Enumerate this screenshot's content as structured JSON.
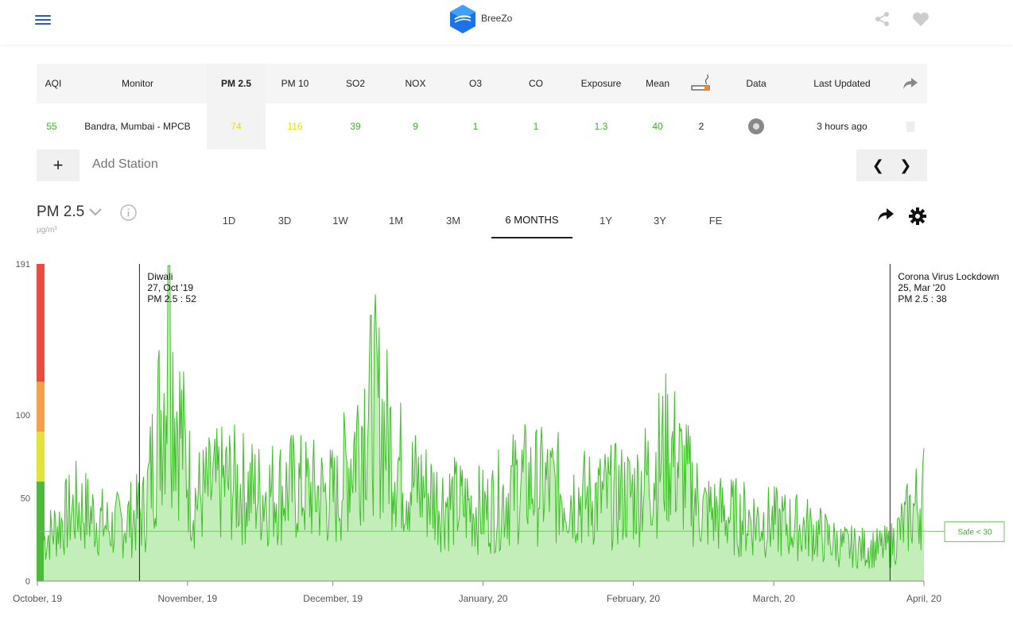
{
  "header": {
    "brand": "BreeZo"
  },
  "table": {
    "columns": [
      "AQI",
      "Monitor",
      "PM 2.5",
      "PM 10",
      "SO2",
      "NOX",
      "O3",
      "CO",
      "Exposure",
      "Mean",
      "Data",
      "Last Updated"
    ],
    "row": {
      "aqi": "55",
      "monitor": "Bandra, Mumbai - MPCB",
      "pm25": "74",
      "pm10": "116",
      "so2": "39",
      "nox": "9",
      "o3": "1",
      "co": "1",
      "exposure": "1.3",
      "mean": "40",
      "cigarettes": "2",
      "last_updated": "3 hours ago"
    }
  },
  "add_station": {
    "placeholder": "Add Station",
    "plus": "+"
  },
  "metric": {
    "name": "PM 2.5",
    "unit": "µg/m³"
  },
  "tabs": [
    "1D",
    "3D",
    "1W",
    "1M",
    "3M",
    "6 MONTHS",
    "1Y",
    "3Y",
    "FE"
  ],
  "active_tab": "6 MONTHS",
  "colors": {
    "accent": "#2f56c9",
    "series": "#3fbf2a",
    "fill": "#c4eeb9",
    "good": "#4cba3a",
    "moderate": "#e3e43a",
    "poor": "#f5a04a",
    "severe": "#ee4b40"
  },
  "chart_data": {
    "type": "area",
    "x": [
      "2019-10-01",
      "2019-10-08",
      "2019-10-15",
      "2019-10-22",
      "2019-10-27",
      "2019-11-01",
      "2019-11-08",
      "2019-11-15",
      "2019-11-22",
      "2019-12-01",
      "2019-12-08",
      "2019-12-15",
      "2019-12-22",
      "2020-01-01",
      "2020-01-08",
      "2020-01-15",
      "2020-01-22",
      "2020-02-01",
      "2020-02-08",
      "2020-02-15",
      "2020-02-22",
      "2020-03-01",
      "2020-03-08",
      "2020-03-15",
      "2020-03-22",
      "2020-03-25",
      "2020-04-01"
    ],
    "series": [
      {
        "values": [
          35,
          65,
          45,
          60,
          190,
          70,
          85,
          75,
          80,
          72,
          160,
          90,
          70,
          60,
          85,
          80,
          70,
          75,
          115,
          60,
          55,
          50,
          45,
          30,
          28,
          30,
          75
        ]
      }
    ],
    "tick_labels": [
      "October, 19",
      "November, 19",
      "December, 19",
      "January, 20",
      "February, 20",
      "March, 20",
      "April, 20"
    ],
    "y_ticks": [
      0,
      50,
      100,
      191
    ],
    "ylim": [
      0,
      191
    ],
    "safe_line": {
      "value": 30,
      "label": "Safe < 30"
    },
    "annotations": [
      {
        "date": "2019-10-27",
        "title": "Diwali",
        "date_label": "27, Oct '19",
        "value_label": "PM 2.5 : 52"
      },
      {
        "date": "2020-03-25",
        "title": "Corona Virus Lockdown",
        "date_label": "25, Mar '20",
        "value_label": "PM 2.5 : 38"
      }
    ],
    "bands": [
      {
        "name": "good",
        "from": 0,
        "to": 60
      },
      {
        "name": "moderate",
        "from": 60,
        "to": 90
      },
      {
        "name": "poor",
        "from": 90,
        "to": 120
      },
      {
        "name": "severe",
        "from": 120,
        "to": 191
      }
    ]
  }
}
